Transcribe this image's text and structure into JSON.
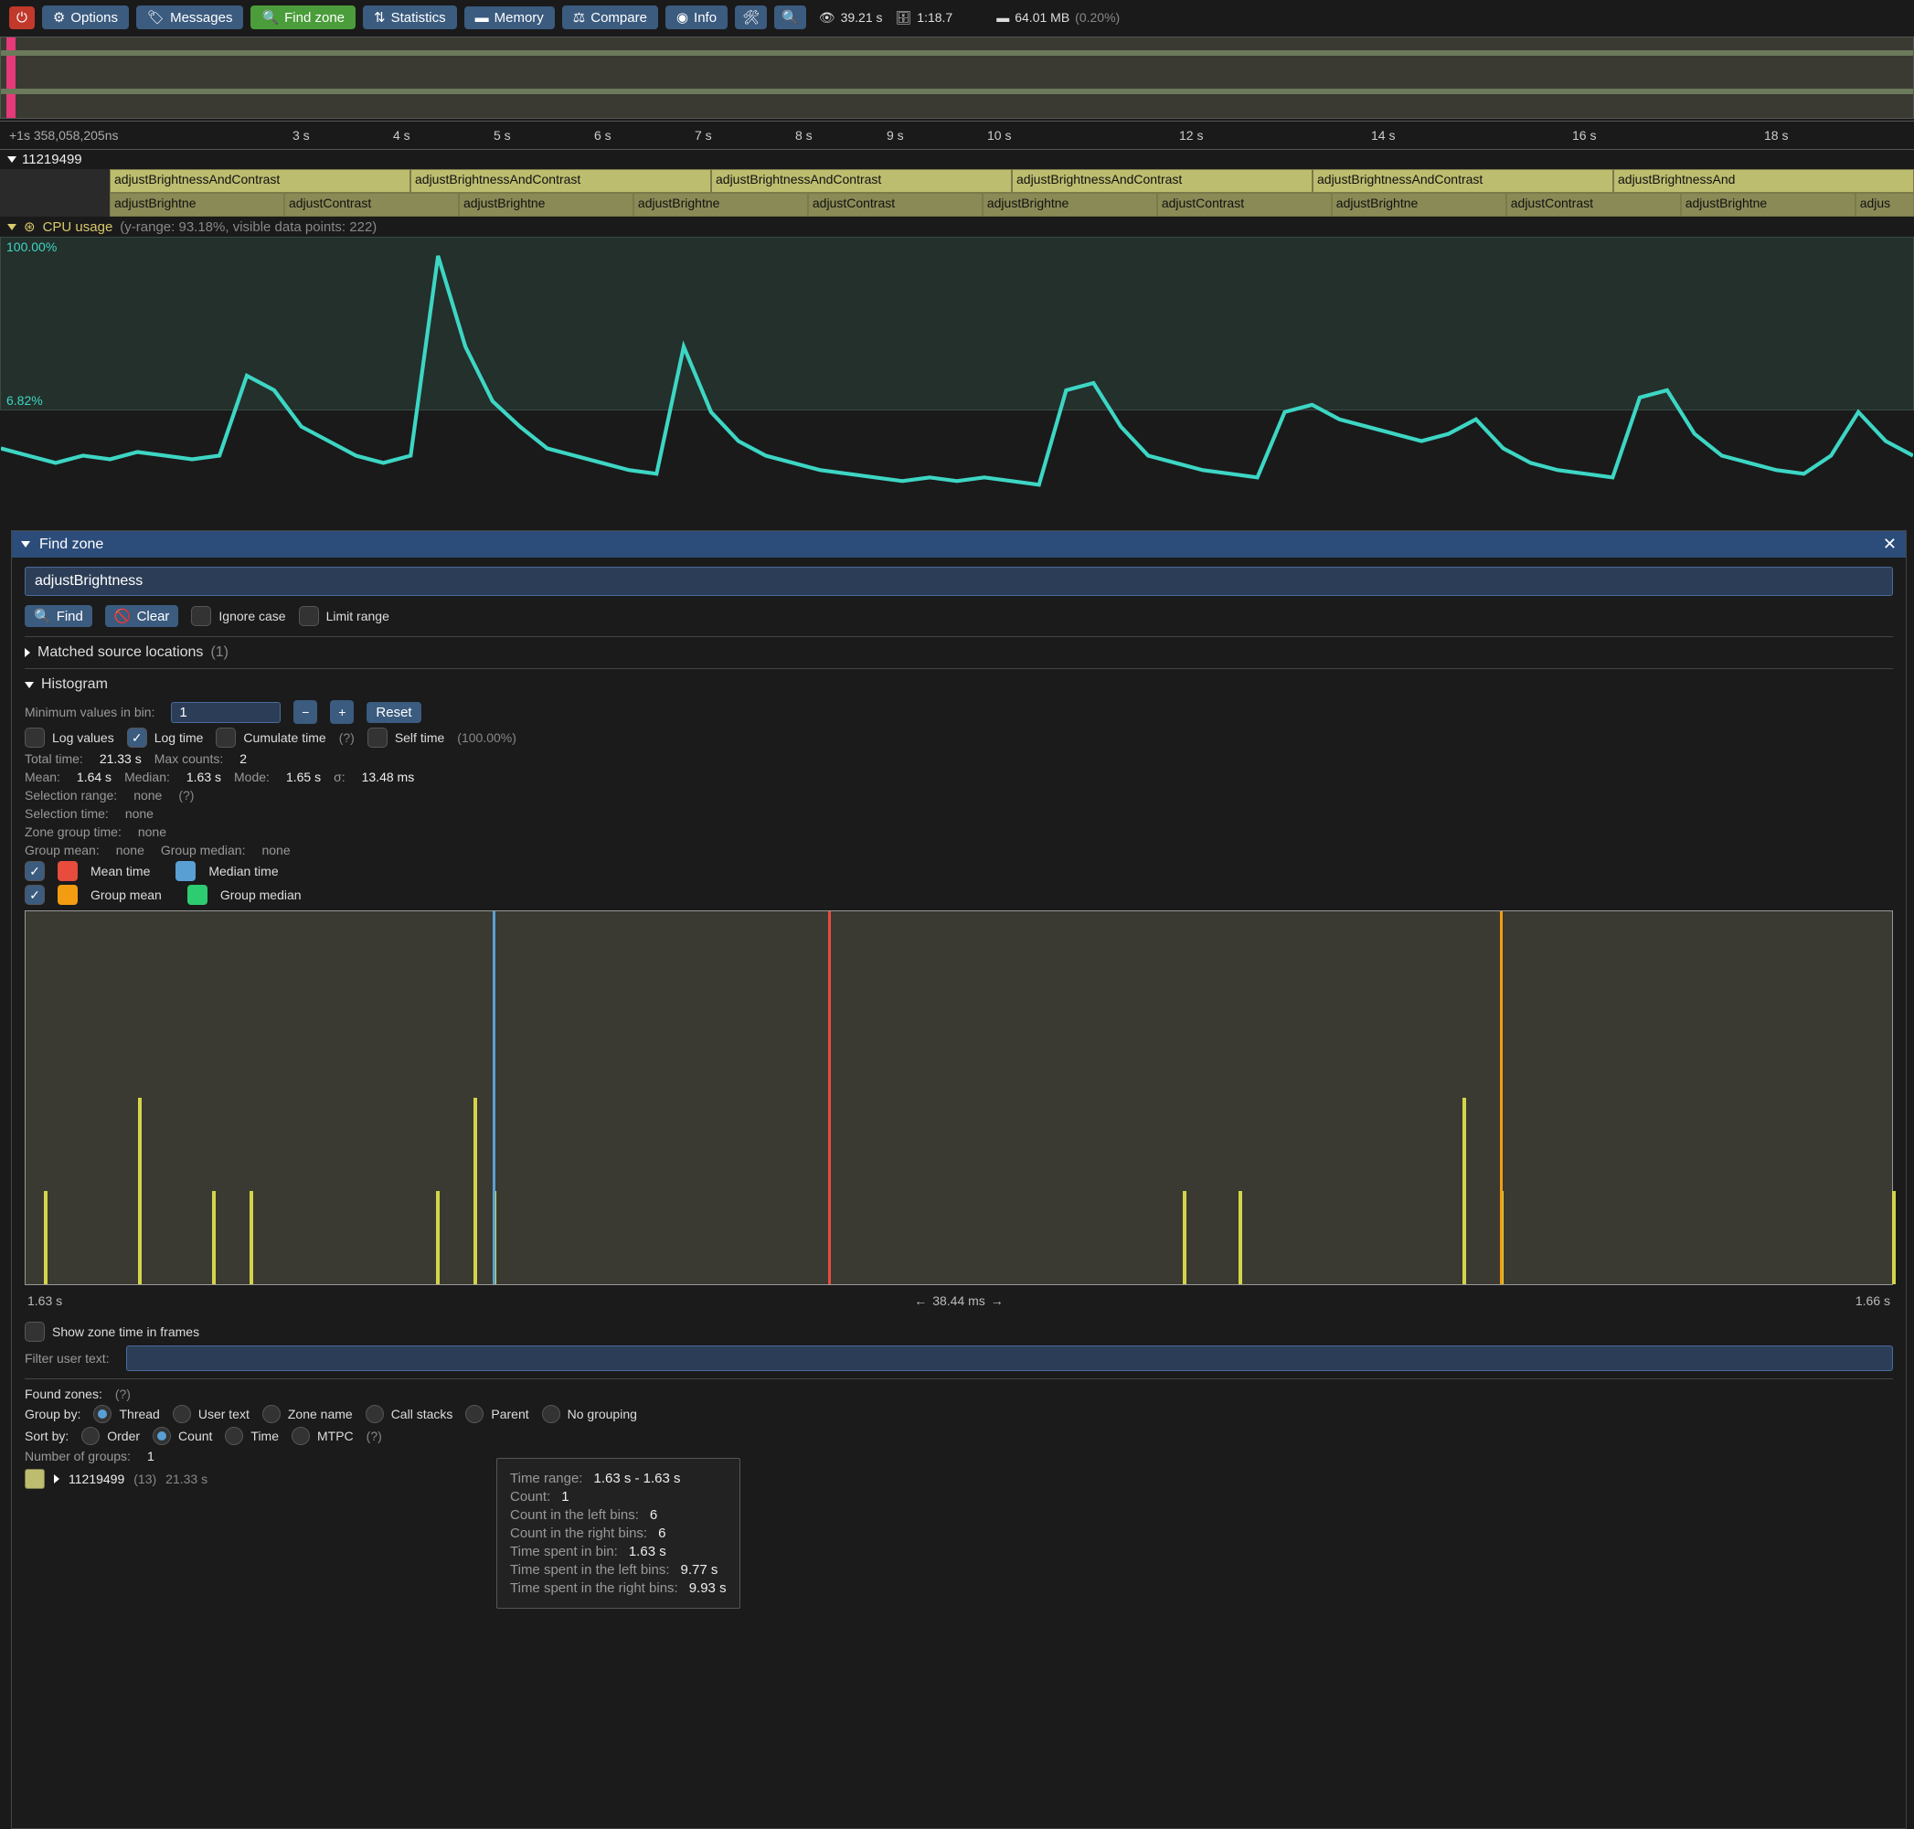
{
  "toolbar": {
    "options": "Options",
    "messages": "Messages",
    "find_zone": "Find zone",
    "statistics": "Statistics",
    "memory": "Memory",
    "compare": "Compare",
    "info": "Info",
    "time": "39.21 s",
    "ratio": "1:18.7",
    "mem": "64.01 MB",
    "mem_pct": "(0.20%)"
  },
  "ruler": {
    "start": "+1s 358,058,205ns",
    "ticks": [
      "3 s",
      "4 s",
      "5 s",
      "6 s",
      "7 s",
      "8 s",
      "9 s",
      "10 s",
      "12 s",
      "14 s",
      "16 s",
      "18 s"
    ]
  },
  "thread": {
    "id": "11219499"
  },
  "zones": {
    "row1": [
      "adjustBrightnessAndContrast",
      "adjustBrightnessAndContrast",
      "adjustBrightnessAndContrast",
      "adjustBrightnessAndContrast",
      "adjustBrightnessAndContrast",
      "adjustBrightnessAnd"
    ],
    "row2": [
      "adjustBrightne",
      "adjustContrast",
      "adjustBrightne",
      "adjustBrightne",
      "adjustContrast",
      "adjustBrightne",
      "adjustContrast",
      "adjustBrightne",
      "adjustContrast",
      "adjustBrightne",
      "adjus"
    ]
  },
  "cpu": {
    "label": "CPU usage",
    "range": "(y-range: 93.18%, visible data points: 222)",
    "top": "100.00%",
    "bot": "6.82%"
  },
  "find": {
    "title": "Find zone",
    "search": "adjustBrightness",
    "find_btn": "Find",
    "clear_btn": "Clear",
    "ignore_case": "Ignore case",
    "limit_range": "Limit range",
    "matched": "Matched source locations",
    "matched_cnt": "(1)",
    "hist_label": "Histogram",
    "min_bin_label": "Minimum values in bin:",
    "min_bin_val": "1",
    "reset": "Reset",
    "log_values": "Log values",
    "log_time": "Log time",
    "cumulate": "Cumulate time",
    "cumulate_q": "(?)",
    "self_time": "Self time",
    "self_pct": "(100.00%)",
    "total_time_l": "Total time:",
    "total_time_v": "21.33 s",
    "max_counts_l": "Max counts:",
    "max_counts_v": "2",
    "mean_l": "Mean:",
    "mean_v": "1.64 s",
    "median_l": "Median:",
    "median_v": "1.63 s",
    "mode_l": "Mode:",
    "mode_v": "1.65 s",
    "sigma_l": "σ:",
    "sigma_v": "13.48 ms",
    "sel_range_l": "Selection range:",
    "sel_range_v": "none",
    "sel_range_q": "(?)",
    "sel_time_l": "Selection time:",
    "sel_time_v": "none",
    "zone_grp_l": "Zone group time:",
    "zone_grp_v": "none",
    "grp_mean_l": "Group mean:",
    "grp_mean_v": "none",
    "grp_median_l": "Group median:",
    "grp_median_v": "none",
    "legend_mean": "Mean time",
    "legend_median": "Median time",
    "legend_gmean": "Group mean",
    "legend_gmedian": "Group median",
    "hist_left": "1.63 s",
    "hist_right": "1.66 s",
    "hist_mid": "38.44 ms",
    "show_frames": "Show zone time in frames",
    "filter_label": "Filter user text:",
    "found_zones": "Found zones:",
    "found_q": "(?)",
    "group_by": "Group by:",
    "gb_thread": "Thread",
    "gb_user": "User text",
    "gb_zone": "Zone name",
    "gb_call": "Call stacks",
    "gb_parent": "Parent",
    "gb_none": "No grouping",
    "sort_by": "Sort by:",
    "sb_order": "Order",
    "sb_count": "Count",
    "sb_time": "Time",
    "sb_mtpc": "MTPC",
    "sb_q": "(?)",
    "numgrp_l": "Number of groups:",
    "numgrp_v": "1",
    "grp_id": "11219499",
    "grp_cnt": "(13)",
    "grp_time": "21.33 s"
  },
  "tooltip": {
    "tr_l": "Time range:",
    "tr_v": "1.63 s - 1.63 s",
    "c_l": "Count:",
    "c_v": "1",
    "cl_l": "Count in the left bins:",
    "cl_v": "6",
    "cr_l": "Count in the right bins:",
    "cr_v": "6",
    "tb_l": "Time spent in bin:",
    "tb_v": "1.63 s",
    "tl_l": "Time spent in the left bins:",
    "tl_v": "9.77 s",
    "trr_l": "Time spent in the right bins:",
    "trr_v": "9.93 s"
  },
  "chart_data": {
    "cpu_line": {
      "type": "line",
      "ylim": [
        6.82,
        100.0
      ],
      "points": [
        42,
        40,
        38,
        40,
        39,
        41,
        40,
        39,
        40,
        62,
        58,
        48,
        44,
        40,
        38,
        40,
        95,
        70,
        55,
        48,
        42,
        40,
        38,
        36,
        35,
        70,
        52,
        44,
        40,
        38,
        36,
        35,
        34,
        33,
        34,
        33,
        34,
        33,
        32,
        58,
        60,
        48,
        40,
        38,
        36,
        35,
        34,
        52,
        54,
        50,
        48,
        46,
        44,
        46,
        50,
        42,
        38,
        36,
        35,
        34,
        56,
        58,
        46,
        40,
        38,
        36,
        35,
        40,
        52,
        44,
        40
      ]
    },
    "histogram": {
      "type": "bar",
      "xlim": [
        "1.63 s",
        "1.66 s"
      ],
      "bars_pct_x": [
        1,
        6,
        10,
        12,
        22,
        24,
        25,
        62,
        65,
        77,
        79,
        100
      ],
      "bars_h_pct": [
        50,
        100,
        50,
        50,
        50,
        100,
        50,
        50,
        50,
        100,
        50,
        50
      ],
      "median_line_pct_x": 25,
      "mean_line_pct_x": 43,
      "gmean_line_pct_x": 79
    }
  }
}
